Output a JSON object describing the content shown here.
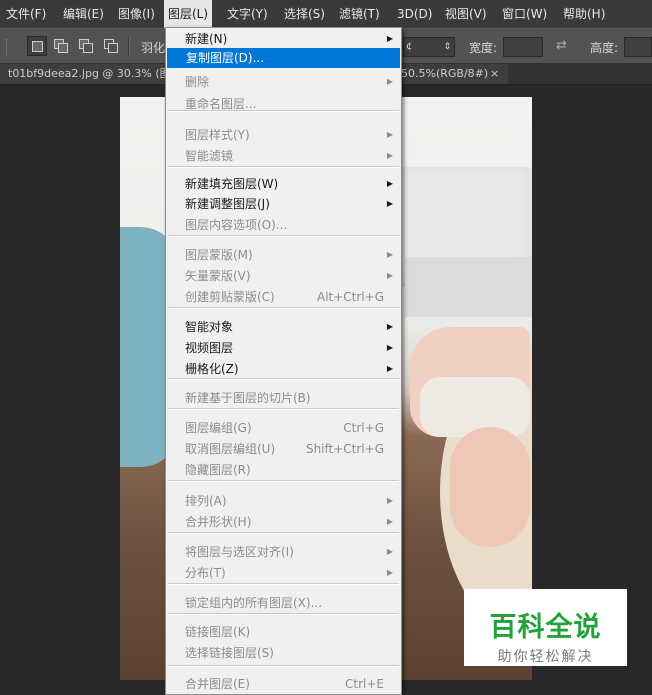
{
  "menubar": {
    "items": [
      "文件(F)",
      "编辑(E)",
      "图像(I)",
      "图层(L)",
      "文字(Y)",
      "选择(S)",
      "滤镜(T)",
      "3D(D)",
      "视图(V)",
      "窗口(W)",
      "帮助(H)"
    ],
    "active_index": 3
  },
  "options": {
    "feather_label": "羽化",
    "style_value": "¢",
    "width_label": "宽度:",
    "height_label": "高度:"
  },
  "tab": {
    "title_left": "t01bf9deea2.jpg @ 30.3% (图",
    "title_right": "50.5%(RGB/8#)",
    "close": "×"
  },
  "layer_menu": {
    "items": [
      {
        "label": "新建(N)",
        "shortcut": "",
        "submenu": true,
        "disabled": false,
        "highlighted": false
      },
      {
        "label": "复制图层(D)...",
        "shortcut": "",
        "submenu": false,
        "disabled": false,
        "highlighted": true
      },
      {
        "label": "删除",
        "shortcut": "",
        "submenu": true,
        "disabled": true,
        "highlighted": false
      },
      {
        "label": "重命名图层...",
        "shortcut": "",
        "submenu": false,
        "disabled": true,
        "highlighted": false
      },
      {
        "label": "图层样式(Y)",
        "shortcut": "",
        "submenu": true,
        "disabled": true,
        "highlighted": false
      },
      {
        "label": "智能滤镜",
        "shortcut": "",
        "submenu": true,
        "disabled": true,
        "highlighted": false
      },
      {
        "label": "新建填充图层(W)",
        "shortcut": "",
        "submenu": true,
        "disabled": false,
        "highlighted": false
      },
      {
        "label": "新建调整图层(J)",
        "shortcut": "",
        "submenu": true,
        "disabled": false,
        "highlighted": false
      },
      {
        "label": "图层内容选项(O)...",
        "shortcut": "",
        "submenu": false,
        "disabled": true,
        "highlighted": false
      },
      {
        "label": "图层蒙版(M)",
        "shortcut": "",
        "submenu": true,
        "disabled": true,
        "highlighted": false
      },
      {
        "label": "矢量蒙版(V)",
        "shortcut": "",
        "submenu": true,
        "disabled": true,
        "highlighted": false
      },
      {
        "label": "创建剪贴蒙版(C)",
        "shortcut": "Alt+Ctrl+G",
        "submenu": false,
        "disabled": true,
        "highlighted": false
      },
      {
        "label": "智能对象",
        "shortcut": "",
        "submenu": true,
        "disabled": false,
        "highlighted": false
      },
      {
        "label": "视频图层",
        "shortcut": "",
        "submenu": true,
        "disabled": false,
        "highlighted": false
      },
      {
        "label": "栅格化(Z)",
        "shortcut": "",
        "submenu": true,
        "disabled": false,
        "highlighted": false
      },
      {
        "label": "新建基于图层的切片(B)",
        "shortcut": "",
        "submenu": false,
        "disabled": true,
        "highlighted": false
      },
      {
        "label": "图层编组(G)",
        "shortcut": "Ctrl+G",
        "submenu": false,
        "disabled": true,
        "highlighted": false
      },
      {
        "label": "取消图层编组(U)",
        "shortcut": "Shift+Ctrl+G",
        "submenu": false,
        "disabled": true,
        "highlighted": false
      },
      {
        "label": "隐藏图层(R)",
        "shortcut": "",
        "submenu": false,
        "disabled": true,
        "highlighted": false
      },
      {
        "label": "排列(A)",
        "shortcut": "",
        "submenu": true,
        "disabled": true,
        "highlighted": false
      },
      {
        "label": "合并形状(H)",
        "shortcut": "",
        "submenu": true,
        "disabled": true,
        "highlighted": false
      },
      {
        "label": "将图层与选区对齐(I)",
        "shortcut": "",
        "submenu": true,
        "disabled": true,
        "highlighted": false
      },
      {
        "label": "分布(T)",
        "shortcut": "",
        "submenu": true,
        "disabled": true,
        "highlighted": false
      },
      {
        "label": "锁定组内的所有图层(X)...",
        "shortcut": "",
        "submenu": false,
        "disabled": true,
        "highlighted": false
      },
      {
        "label": "链接图层(K)",
        "shortcut": "",
        "submenu": false,
        "disabled": true,
        "highlighted": false
      },
      {
        "label": "选择链接图层(S)",
        "shortcut": "",
        "submenu": false,
        "disabled": true,
        "highlighted": false
      },
      {
        "label": "合并图层(E)",
        "shortcut": "Ctrl+E",
        "submenu": false,
        "disabled": true,
        "highlighted": false
      }
    ]
  },
  "watermark": {
    "brand": "百科全说",
    "slogan": "助你轻松解决"
  }
}
